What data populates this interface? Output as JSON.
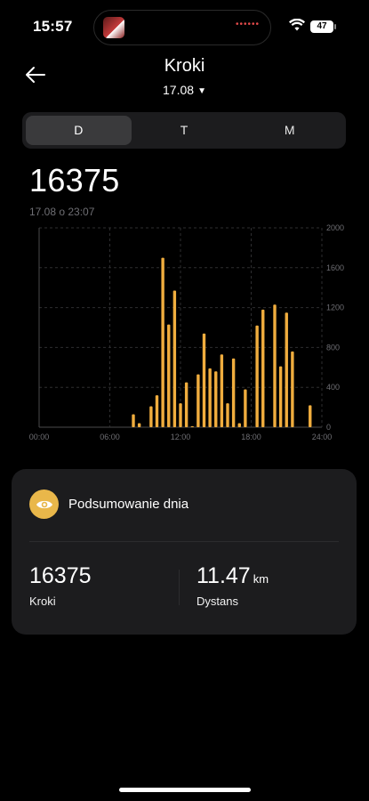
{
  "status": {
    "time": "15:57",
    "battery": "47"
  },
  "header": {
    "title": "Kroki",
    "date": "17.08"
  },
  "tabs": [
    {
      "label": "D",
      "active": true
    },
    {
      "label": "T",
      "active": false
    },
    {
      "label": "M",
      "active": false
    }
  ],
  "summary": {
    "value": "16375",
    "updated": "17.08 o 23:07"
  },
  "chart_data": {
    "type": "bar",
    "x_ticks": [
      "00:00",
      "06:00",
      "12:00",
      "18:00",
      "24:00"
    ],
    "y_ticks": [
      "0",
      "400",
      "800",
      "1200",
      "1600",
      "2000"
    ],
    "ylim": [
      0,
      2000
    ],
    "xlim_hours": [
      0,
      24
    ],
    "bar_color": "#f0ad3e",
    "bars": [
      {
        "hour": 8.0,
        "value": 130
      },
      {
        "hour": 8.5,
        "value": 40
      },
      {
        "hour": 9.5,
        "value": 210
      },
      {
        "hour": 10.0,
        "value": 320
      },
      {
        "hour": 10.5,
        "value": 1700
      },
      {
        "hour": 11.0,
        "value": 1030
      },
      {
        "hour": 11.5,
        "value": 1370
      },
      {
        "hour": 12.0,
        "value": 240
      },
      {
        "hour": 12.5,
        "value": 450
      },
      {
        "hour": 13.0,
        "value": 10
      },
      {
        "hour": 13.5,
        "value": 530
      },
      {
        "hour": 14.0,
        "value": 940
      },
      {
        "hour": 14.5,
        "value": 590
      },
      {
        "hour": 15.0,
        "value": 560
      },
      {
        "hour": 15.5,
        "value": 730
      },
      {
        "hour": 16.0,
        "value": 240
      },
      {
        "hour": 16.5,
        "value": 690
      },
      {
        "hour": 17.0,
        "value": 40
      },
      {
        "hour": 17.5,
        "value": 380
      },
      {
        "hour": 18.5,
        "value": 1020
      },
      {
        "hour": 19.0,
        "value": 1180
      },
      {
        "hour": 20.0,
        "value": 1230
      },
      {
        "hour": 20.5,
        "value": 610
      },
      {
        "hour": 21.0,
        "value": 1150
      },
      {
        "hour": 21.5,
        "value": 760
      },
      {
        "hour": 23.0,
        "value": 220
      }
    ]
  },
  "card": {
    "title": "Podsumowanie dnia",
    "icon": "eye-icon",
    "steps": {
      "value": "16375",
      "label": "Kroki"
    },
    "distance": {
      "value": "11.47",
      "unit": "km",
      "label": "Dystans"
    }
  }
}
